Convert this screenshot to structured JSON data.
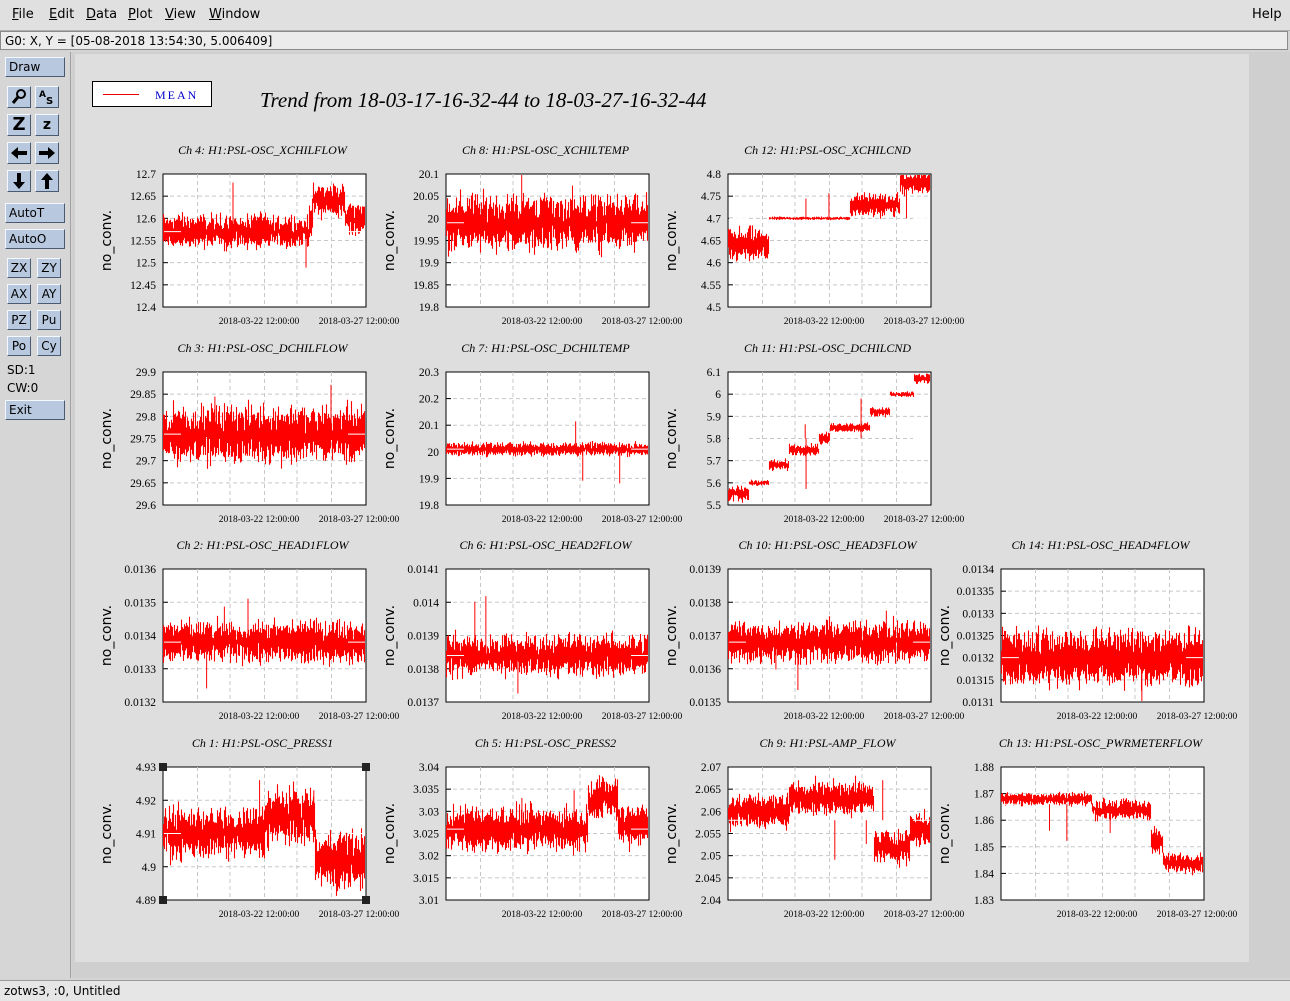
{
  "menubar": {
    "items": [
      {
        "label": "File",
        "u": "F",
        "rest": "ile"
      },
      {
        "label": "Edit",
        "u": "E",
        "rest": "dit"
      },
      {
        "label": "Data",
        "u": "D",
        "rest": "ata"
      },
      {
        "label": "Plot",
        "u": "P",
        "rest": "lot"
      },
      {
        "label": "View",
        "u": "V",
        "rest": "iew"
      },
      {
        "label": "Window",
        "u": "W",
        "rest": "indow"
      }
    ],
    "help": "Help"
  },
  "coord_readout": "G0: X, Y = [05-08-2018 13:54:30, 5.006409]",
  "toolbar": {
    "draw": "Draw",
    "autot": "AutoT",
    "autoo": "AutoO",
    "small_buttons": [
      "ZX",
      "ZY",
      "AX",
      "AY",
      "PZ",
      "Pu",
      "Po",
      "Cy"
    ],
    "sd": "SD:1",
    "cw": "CW:0",
    "exit": "Exit"
  },
  "legend": {
    "label": "MEAN"
  },
  "title": "Trend from 18-03-17-16-32-44 to 18-03-27-16-32-44",
  "status": "zotws3, :0, Untitled",
  "colors": {
    "trace": "#ff0000",
    "mean_line": "#ffffff",
    "plot_bg": "#ffffff"
  },
  "chart_data": [
    {
      "type": "line",
      "title": "Ch 4: H1:PSL-OSC_XCHILFLOW",
      "ylabel": "no_conv.",
      "ylim": [
        12.4,
        12.7
      ],
      "yticks": [
        "12.7",
        "12.65",
        "12.6",
        "12.55",
        "12.5",
        "12.45",
        "12.4"
      ],
      "xticks": [
        "2018-03-22 12:00:00",
        "2018-03-27 12:00:00"
      ],
      "grid": true,
      "mean": 12.57,
      "segments": [
        [
          0,
          0.72,
          12.57,
          0.03
        ],
        [
          0.72,
          0.74,
          12.6,
          0.04
        ],
        [
          0.74,
          0.9,
          12.64,
          0.03
        ],
        [
          0.9,
          1,
          12.6,
          0.03
        ]
      ]
    },
    {
      "type": "line",
      "title": "Ch 8: H1:PSL-OSC_XCHILTEMP",
      "ylabel": "no_conv.",
      "ylim": [
        19.8,
        20.1
      ],
      "yticks": [
        "20.1",
        "20.05",
        "20",
        "19.95",
        "19.9",
        "19.85",
        "19.8"
      ],
      "xticks": [
        "2018-03-22 12:00:00",
        "2018-03-27 12:00:00"
      ],
      "grid": true,
      "mean": 19.99,
      "segments": [
        [
          0,
          1,
          19.99,
          0.05
        ]
      ]
    },
    {
      "type": "line",
      "title": "Ch 12: H1:PSL-OSC_XCHILCND",
      "ylabel": "no_conv.",
      "ylim": [
        4.5,
        4.8
      ],
      "yticks": [
        "4.8",
        "4.75",
        "4.7",
        "4.65",
        "4.6",
        "4.55",
        "4.5"
      ],
      "xticks": [
        "2018-03-22 12:00:00",
        "2018-03-27 12:00:00"
      ],
      "grid": true,
      "mean": 4.7,
      "segments": [
        [
          0,
          0.2,
          4.64,
          0.03
        ],
        [
          0.2,
          0.6,
          4.7,
          0.003
        ],
        [
          0.6,
          0.85,
          4.73,
          0.02
        ],
        [
          0.85,
          1,
          4.78,
          0.02
        ]
      ]
    },
    {
      "type": "line",
      "title": "Ch 3: H1:PSL-OSC_DCHILFLOW",
      "ylabel": "no_conv.",
      "ylim": [
        29.6,
        29.9
      ],
      "yticks": [
        "29.9",
        "29.85",
        "29.8",
        "29.75",
        "29.7",
        "29.65",
        "29.6"
      ],
      "xticks": [
        "2018-03-22 12:00:00",
        "2018-03-27 12:00:00"
      ],
      "grid": true,
      "mean": 29.76,
      "segments": [
        [
          0,
          1,
          29.76,
          0.05
        ]
      ]
    },
    {
      "type": "line",
      "title": "Ch 7: H1:PSL-OSC_DCHILTEMP",
      "ylabel": "no_conv.",
      "ylim": [
        19.8,
        20.3
      ],
      "yticks": [
        "20.3",
        "20.2",
        "20.1",
        "20",
        "19.9",
        "19.8"
      ],
      "xticks": [
        "2018-03-22 12:00:00",
        "2018-03-27 12:00:00"
      ],
      "grid": true,
      "mean": 20.01,
      "segments": [
        [
          0,
          1,
          20.01,
          0.02
        ]
      ]
    },
    {
      "type": "line",
      "title": "Ch 11: H1:PSL-OSC_DCHILCND",
      "ylabel": "no_conv.",
      "ylim": [
        5.5,
        6.1
      ],
      "yticks": [
        "6.1",
        "6",
        "5.9",
        "5.8",
        "5.7",
        "5.6",
        "5.5"
      ],
      "xticks": [
        "2018-03-22 12:00:00",
        "2018-03-27 12:00:00"
      ],
      "grid": true,
      "mean": 5.8,
      "segments": [
        [
          0,
          0.1,
          5.55,
          0.03
        ],
        [
          0.1,
          0.2,
          5.6,
          0.01
        ],
        [
          0.2,
          0.3,
          5.68,
          0.02
        ],
        [
          0.3,
          0.45,
          5.75,
          0.02
        ],
        [
          0.45,
          0.5,
          5.8,
          0.02
        ],
        [
          0.5,
          0.7,
          5.85,
          0.015
        ],
        [
          0.7,
          0.8,
          5.92,
          0.02
        ],
        [
          0.8,
          0.92,
          6.0,
          0.01
        ],
        [
          0.92,
          1,
          6.07,
          0.02
        ]
      ]
    },
    {
      "type": "line",
      "title": "Ch 2: H1:PSL-OSC_HEAD1FLOW",
      "ylabel": "no_conv.",
      "ylim": [
        0.0132,
        0.0136
      ],
      "yticks": [
        "0.0136",
        "0.0135",
        "0.0134",
        "0.0133",
        "0.0132"
      ],
      "xticks": [
        "2018-03-22 12:00:00",
        "2018-03-27 12:00:00"
      ],
      "grid": true,
      "mean": 0.01338,
      "segments": [
        [
          0,
          1,
          0.01338,
          5e-05
        ]
      ]
    },
    {
      "type": "line",
      "title": "Ch 6: H1:PSL-OSC_HEAD2FLOW",
      "ylabel": "no_conv.",
      "ylim": [
        0.0137,
        0.0141
      ],
      "yticks": [
        "0.0141",
        "0.014",
        "0.0139",
        "0.0138",
        "0.0137"
      ],
      "xticks": [
        "2018-03-22 12:00:00",
        "2018-03-27 12:00:00"
      ],
      "grid": true,
      "mean": 0.01384,
      "segments": [
        [
          0,
          1,
          0.01384,
          5e-05
        ]
      ]
    },
    {
      "type": "line",
      "title": "Ch 10: H1:PSL-OSC_HEAD3FLOW",
      "ylabel": "no_conv.",
      "ylim": [
        0.0135,
        0.0139
      ],
      "yticks": [
        "0.0139",
        "0.0138",
        "0.0137",
        "0.0136",
        "0.0135"
      ],
      "xticks": [
        "2018-03-22 12:00:00",
        "2018-03-27 12:00:00"
      ],
      "grid": true,
      "mean": 0.01368,
      "segments": [
        [
          0,
          1,
          0.01368,
          5e-05
        ]
      ]
    },
    {
      "type": "line",
      "title": "Ch 14: H1:PSL-OSC_HEAD4FLOW",
      "ylabel": "no_conv.",
      "ylim": [
        0.0131,
        0.0134
      ],
      "yticks": [
        "0.0134",
        "0.01335",
        "0.0133",
        "0.01325",
        "0.0132",
        "0.01315",
        "0.0131"
      ],
      "xticks": [
        "2018-03-22 12:00:00",
        "2018-03-27 12:00:00"
      ],
      "grid": true,
      "mean": 0.0132,
      "segments": [
        [
          0,
          1,
          0.0132,
          5e-05
        ]
      ]
    },
    {
      "type": "line",
      "title": "Ch 1: H1:PSL-OSC_PRESS1",
      "ylabel": "no_conv.",
      "ylim": [
        4.89,
        4.93
      ],
      "yticks": [
        "4.93",
        "4.92",
        "4.91",
        "4.9",
        "4.89"
      ],
      "xticks": [
        "2018-03-22 12:00:00",
        "2018-03-27 12:00:00"
      ],
      "grid": true,
      "mean": 4.91,
      "selected": true,
      "segments": [
        [
          0,
          0.5,
          4.91,
          0.006
        ],
        [
          0.5,
          0.75,
          4.915,
          0.007
        ],
        [
          0.75,
          1,
          4.902,
          0.007
        ]
      ]
    },
    {
      "type": "line",
      "title": "Ch 5: H1:PSL-OSC_PRESS2",
      "ylabel": "no_conv.",
      "ylim": [
        3.01,
        3.04
      ],
      "yticks": [
        "3.04",
        "3.035",
        "3.03",
        "3.025",
        "3.02",
        "3.015",
        "3.01"
      ],
      "xticks": [
        "2018-03-22 12:00:00",
        "2018-03-27 12:00:00"
      ],
      "grid": true,
      "mean": 3.026,
      "segments": [
        [
          0,
          0.7,
          3.026,
          0.004
        ],
        [
          0.7,
          0.85,
          3.033,
          0.004
        ],
        [
          0.85,
          1,
          3.027,
          0.004
        ]
      ]
    },
    {
      "type": "line",
      "title": "Ch 9: H1:PSL-AMP_FLOW",
      "ylabel": "no_conv.",
      "ylim": [
        2.04,
        2.07
      ],
      "yticks": [
        "2.07",
        "2.065",
        "2.06",
        "2.055",
        "2.05",
        "2.045",
        "2.04"
      ],
      "xticks": [
        "2018-03-22 12:00:00",
        "2018-03-27 12:00:00"
      ],
      "grid": true,
      "mean": 2.058,
      "segments": [
        [
          0,
          0.3,
          2.06,
          0.003
        ],
        [
          0.3,
          0.72,
          2.063,
          0.003
        ],
        [
          0.72,
          0.9,
          2.052,
          0.003
        ],
        [
          0.9,
          1,
          2.056,
          0.003
        ]
      ]
    },
    {
      "type": "line",
      "title": "Ch 13: H1:PSL-OSC_PWRMETERFLOW",
      "ylabel": "no_conv.",
      "ylim": [
        1.83,
        1.88
      ],
      "yticks": [
        "1.88",
        "1.87",
        "1.86",
        "1.85",
        "1.84",
        "1.83"
      ],
      "xticks": [
        "2018-03-22 12:00:00",
        "2018-03-27 12:00:00"
      ],
      "grid": true,
      "mean": 1.866,
      "segments": [
        [
          0,
          0.45,
          1.868,
          0.002
        ],
        [
          0.45,
          0.74,
          1.864,
          0.003
        ],
        [
          0.74,
          0.8,
          1.852,
          0.004
        ],
        [
          0.8,
          1,
          1.844,
          0.003
        ]
      ]
    }
  ]
}
